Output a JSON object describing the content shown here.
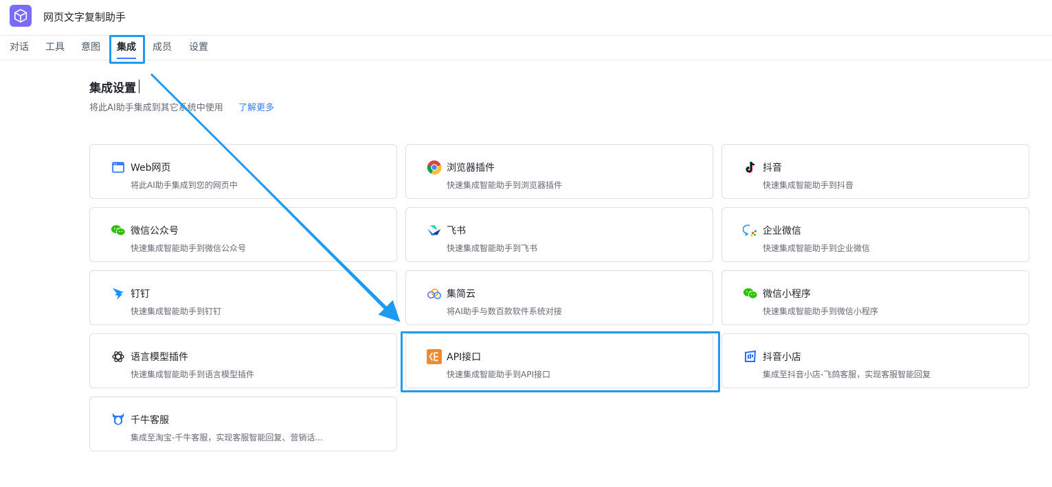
{
  "app": {
    "title": "网页文字复制助手",
    "logo_icon": "cube-icon",
    "logo_color": "#7b6cf6"
  },
  "tabs": [
    {
      "label": "对话"
    },
    {
      "label": "工具"
    },
    {
      "label": "意图"
    },
    {
      "label": "集成",
      "active": true
    },
    {
      "label": "成员"
    },
    {
      "label": "设置"
    }
  ],
  "section": {
    "title": "集成设置",
    "desc": "将此AI助手集成到其它系统中使用",
    "learn_more": "了解更多"
  },
  "integrations": [
    {
      "name": "Web网页",
      "desc": "将此AI助手集成到您的网页中",
      "icon": "browser-window-icon"
    },
    {
      "name": "浏览器插件",
      "desc": "快速集成智能助手到浏览器插件",
      "icon": "chrome-icon"
    },
    {
      "name": "抖音",
      "desc": "快速集成智能助手到抖音",
      "icon": "douyin-icon"
    },
    {
      "name": "微信公众号",
      "desc": "快速集成智能助手到微信公众号",
      "icon": "wechat-icon"
    },
    {
      "name": "飞书",
      "desc": "快速集成智能助手到飞书",
      "icon": "feishu-icon"
    },
    {
      "name": "企业微信",
      "desc": "快速集成智能助手到企业微信",
      "icon": "wecom-icon"
    },
    {
      "name": "钉钉",
      "desc": "快速集成智能助手到钉钉",
      "icon": "dingtalk-icon"
    },
    {
      "name": "集简云",
      "desc": "将AI助手与数百款软件系统对接",
      "icon": "jijianyun-icon"
    },
    {
      "name": "微信小程序",
      "desc": "快速集成智能助手到微信小程序",
      "icon": "wechat-miniprogram-icon"
    },
    {
      "name": "语言模型插件",
      "desc": "快速集成智能助手到语言模型插件",
      "icon": "openai-icon"
    },
    {
      "name": "API接口",
      "desc": "快速集成智能助手到API接口",
      "icon": "api-icon"
    },
    {
      "name": "抖音小店",
      "desc": "集成至抖音小店-飞鸽客服，实现客服智能回复",
      "icon": "douyin-shop-icon"
    },
    {
      "name": "千牛客服",
      "desc": "集成至淘宝-千牛客服，实现客服智能回复、营销话...",
      "icon": "qianniu-icon"
    }
  ],
  "colors": {
    "accent": "#3b7df8",
    "highlight": "#1e9bf0",
    "api_orange": "#f08a2c"
  }
}
